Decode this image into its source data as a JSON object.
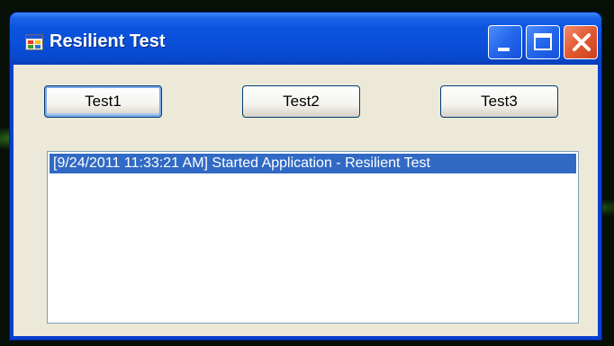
{
  "window": {
    "title": "Resilient Test",
    "icon": "app-form-icon",
    "controls": {
      "minimize_icon": "minimize-icon",
      "maximize_icon": "maximize-icon",
      "close_icon": "close-icon"
    }
  },
  "buttons": [
    {
      "label": "Test1",
      "focused": true
    },
    {
      "label": "Test2",
      "focused": false
    },
    {
      "label": "Test3",
      "focused": false
    }
  ],
  "log": {
    "items": [
      {
        "text": "[9/24/2011 11:33:21 AM] Started Application - Resilient Test",
        "selected": true
      }
    ]
  },
  "colors": {
    "titlebar": "#0a4fd8",
    "client": "#ece9d8",
    "selection": "#316ac5",
    "close_button": "#e25a32"
  }
}
